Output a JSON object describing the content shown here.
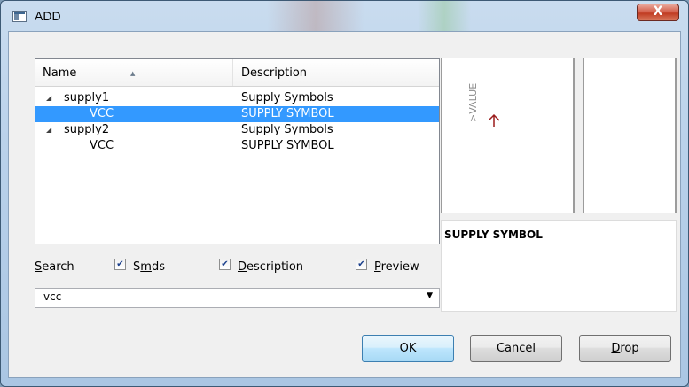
{
  "window": {
    "title": "ADD",
    "close_glyph": "X"
  },
  "tree": {
    "columns": [
      "Name",
      "Description"
    ],
    "rows": [
      {
        "name": "supply1",
        "description": "Supply Symbols",
        "expanded": true,
        "level": 0
      },
      {
        "name": "VCC",
        "description": "SUPPLY SYMBOL",
        "level": 1,
        "selected": true
      },
      {
        "name": "supply2",
        "description": "Supply Symbols",
        "expanded": true,
        "level": 0
      },
      {
        "name": "VCC",
        "description": "SUPPLY SYMBOL",
        "level": 1
      }
    ]
  },
  "options": {
    "search_label": "Search",
    "smds": {
      "label": "Smds",
      "checked": true
    },
    "description": {
      "label": "Description",
      "checked": true
    },
    "preview": {
      "label": "Preview",
      "checked": true
    }
  },
  "search": {
    "value": "vcc"
  },
  "preview": {
    "symbol_value_label": ">VALUE",
    "description": "SUPPLY SYMBOL"
  },
  "buttons": {
    "ok": "OK",
    "cancel": "Cancel",
    "drop": "Drop"
  },
  "colors": {
    "selection": "#3399ff",
    "symbol": "#9b1c1c"
  }
}
